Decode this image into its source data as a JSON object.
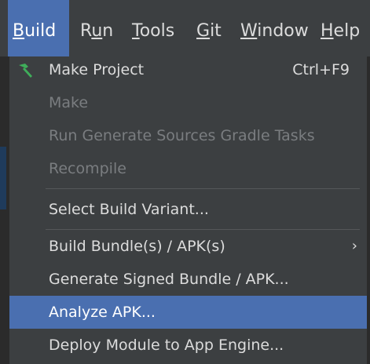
{
  "menubar": {
    "items": [
      {
        "label_pre": "",
        "label_u": "B",
        "label_post": "uild",
        "active": true
      },
      {
        "label_pre": "R",
        "label_u": "u",
        "label_post": "n"
      },
      {
        "label_pre": "",
        "label_u": "T",
        "label_post": "ools"
      },
      {
        "label_pre": "",
        "label_u": "G",
        "label_post": "it"
      },
      {
        "label_pre": "",
        "label_u": "W",
        "label_post": "indow"
      },
      {
        "label_pre": "",
        "label_u": "H",
        "label_post": "elp"
      }
    ]
  },
  "build_menu": {
    "items": [
      {
        "label": "Make Project",
        "shortcut": "Ctrl+F9",
        "icon": "hammer-icon"
      },
      {
        "label": "Make",
        "disabled": true
      },
      {
        "label": "Run Generate Sources Gradle Tasks",
        "disabled": true
      },
      {
        "label": "Recompile",
        "disabled": true
      },
      {
        "label": "Select Build Variant..."
      },
      {
        "label": "Build Bundle(s) / APK(s)",
        "submenu": true,
        "arrow": "›"
      },
      {
        "label": "Generate Signed Bundle / APK..."
      },
      {
        "label": "Analyze APK...",
        "selected": true
      },
      {
        "label": "Deploy Module to App Engine..."
      }
    ]
  },
  "colors": {
    "background": "#3c3f41",
    "selection": "#4a6fb0",
    "hammer": "#3fae5a"
  }
}
